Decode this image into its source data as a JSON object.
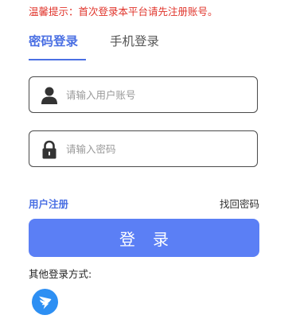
{
  "notice": "温馨提示：首次登录本平台请先注册账号。",
  "tabs": {
    "password_login": "密码登录",
    "phone_login": "手机登录"
  },
  "fields": {
    "username_placeholder": "请输入用户账号",
    "password_placeholder": "请输入密码"
  },
  "links": {
    "register": "用户注册",
    "forgot_password": "找回密码"
  },
  "login_button": "登录",
  "other_login": {
    "label": "其他登录方式:",
    "icon": "dingtalk-icon"
  },
  "colors": {
    "accent": "#4a6fe3",
    "button": "#5b7ff5",
    "notice": "#e0342b",
    "dingtalk": "#2d8ff3"
  }
}
